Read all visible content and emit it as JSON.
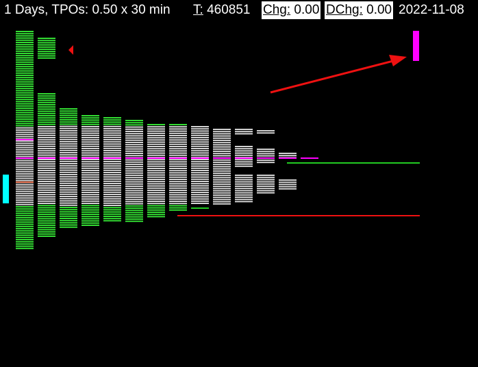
{
  "header": {
    "title": "1 Days, TPOs: 0.50 x 30 min",
    "total_label": "T:",
    "total_value": "460851",
    "chg_label": "Chg:",
    "chg_value": "0.00",
    "dchg_label": "DChg:",
    "dchg_value": "0.00",
    "date": "2022-11-08"
  },
  "colors": {
    "background": "#000000",
    "tpo_value_area": "#d4d4d4",
    "tpo_outside": "#33dd33",
    "poc_line": "#ff00ff",
    "vah_line": "#22cc22",
    "val_line": "#ee1111",
    "arrow": "#ee1111",
    "marker_magenta": "#ff00ff",
    "marker_cyan": "#00ffff"
  },
  "profile": {
    "periods": 13,
    "description_note": ""
  }
}
